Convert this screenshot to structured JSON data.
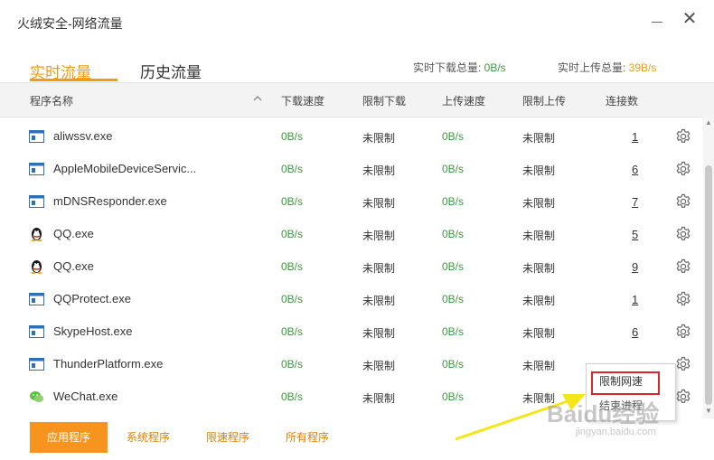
{
  "window": {
    "title": "火绒安全-网络流量",
    "minimize_icon": "minimize-icon",
    "close_icon": "close-icon",
    "close_glyph": "✕"
  },
  "tabs": [
    {
      "label": "实时流量",
      "active": true
    },
    {
      "label": "历史流量",
      "active": false
    }
  ],
  "summary": {
    "download_label": "实时下载总量: ",
    "download_value": "0B/s",
    "upload_label": "实时上传总量: ",
    "upload_value": "39B/s"
  },
  "columns": {
    "name": "程序名称",
    "download_speed": "下载速度",
    "download_limit": "限制下载",
    "upload_speed": "上传速度",
    "upload_limit": "限制上传",
    "connections": "连接数"
  },
  "rows": [
    {
      "icon": "app-window-icon",
      "name": "aliwssv.exe",
      "dl": "0B/s",
      "dl_limit": "未限制",
      "ul": "0B/s",
      "ul_limit": "未限制",
      "conn": "1"
    },
    {
      "icon": "app-window-icon",
      "name": "AppleMobileDeviceServic...",
      "dl": "0B/s",
      "dl_limit": "未限制",
      "ul": "0B/s",
      "ul_limit": "未限制",
      "conn": "6"
    },
    {
      "icon": "app-window-icon",
      "name": "mDNSResponder.exe",
      "dl": "0B/s",
      "dl_limit": "未限制",
      "ul": "0B/s",
      "ul_limit": "未限制",
      "conn": "7"
    },
    {
      "icon": "qq-penguin-icon",
      "name": "QQ.exe",
      "dl": "0B/s",
      "dl_limit": "未限制",
      "ul": "0B/s",
      "ul_limit": "未限制",
      "conn": "5"
    },
    {
      "icon": "qq-penguin-icon",
      "name": "QQ.exe",
      "dl": "0B/s",
      "dl_limit": "未限制",
      "ul": "0B/s",
      "ul_limit": "未限制",
      "conn": "9"
    },
    {
      "icon": "app-window-icon",
      "name": "QQProtect.exe",
      "dl": "0B/s",
      "dl_limit": "未限制",
      "ul": "0B/s",
      "ul_limit": "未限制",
      "conn": "1"
    },
    {
      "icon": "app-window-icon",
      "name": "SkypeHost.exe",
      "dl": "0B/s",
      "dl_limit": "未限制",
      "ul": "0B/s",
      "ul_limit": "未限制",
      "conn": "6"
    },
    {
      "icon": "app-window-icon",
      "name": "ThunderPlatform.exe",
      "dl": "0B/s",
      "dl_limit": "未限制",
      "ul": "0B/s",
      "ul_limit": "未限制",
      "conn": ""
    },
    {
      "icon": "wechat-icon",
      "name": "WeChat.exe",
      "dl": "0B/s",
      "dl_limit": "未限制",
      "ul": "0B/s",
      "ul_limit": "未限制",
      "conn": ""
    }
  ],
  "context_menu": {
    "limit_speed": "限制网速",
    "end_process": "结束进程"
  },
  "bottom_buttons": {
    "apps": "应用程序",
    "system": "系统程序",
    "limited": "限速程序",
    "all": "所有程序"
  },
  "watermark": {
    "main": "Baidu经验",
    "sub": "jingyan.baidu.com"
  },
  "colors": {
    "accent": "#f39c12",
    "button": "#f7941d",
    "speed_green": "#3a9a3a",
    "highlight_red": "#d9262c",
    "arrow_yellow": "#f5e61b"
  }
}
